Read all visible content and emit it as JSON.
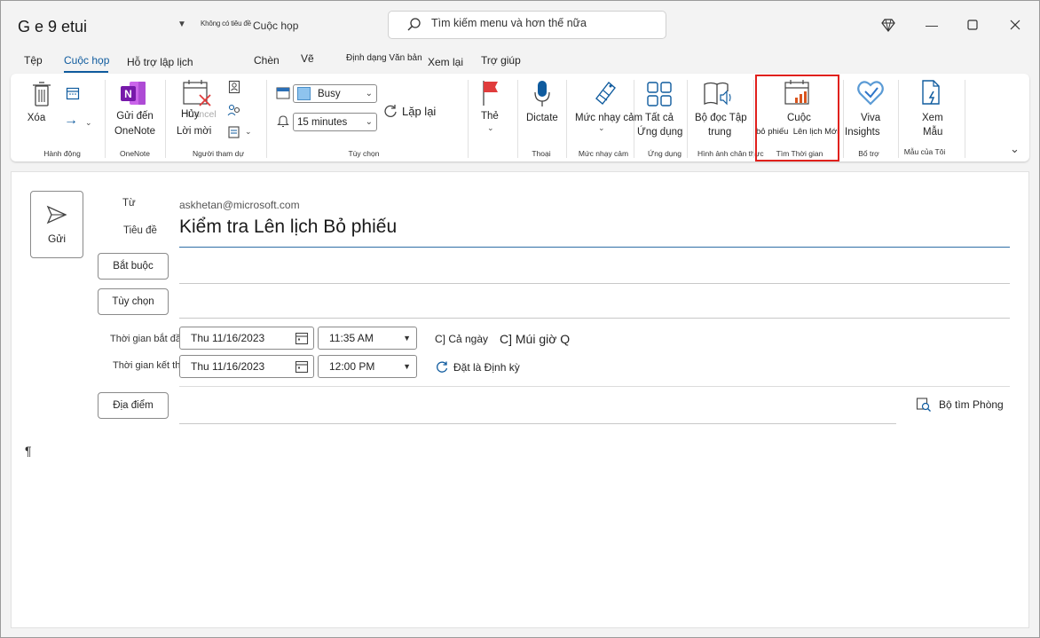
{
  "title_bar": {
    "app_title": "G e 9 etui",
    "qat_small_text": "Không có tiêu đề",
    "qat_item": "Cuộc họp",
    "search_placeholder": "Tìm kiếm menu và hơn thế nữa",
    "icons": [
      "search-icon",
      "diamond-icon",
      "minimize-icon",
      "maximize-icon",
      "close-icon"
    ]
  },
  "tabs": [
    {
      "label": "Tệp"
    },
    {
      "label": "Cuộc họp",
      "active": true
    },
    {
      "label": "Hỗ trợ lập lịch"
    },
    {
      "label": "Chèn"
    },
    {
      "label": "Vẽ"
    },
    {
      "label": "Định dạng Văn bản"
    },
    {
      "label": "Xem lại"
    },
    {
      "label": "Trợ giúp"
    }
  ],
  "ribbon": {
    "groups": {
      "actions": "Hành động",
      "onenote": "OneNote",
      "attendees": "Người tham dự",
      "options": "Tùy chọn",
      "voice": "Thoại",
      "sensitivity": "Mức nhạy cảm",
      "apps": "Ứng dụng",
      "immersive": "Hình ảnh chân thực",
      "find_time": "Tìm Thời gian",
      "addins": "Bổ trợ",
      "templates": "Mẫu của Tôi"
    },
    "delete_label": "Xóa",
    "onenote_label_1": "Gửi đến",
    "onenote_label_2": "OneNote",
    "cancel_label_1": "Hủy",
    "cancel_label_ghost": "Cancel",
    "cancel_label_2": "Lời mời",
    "busy_value": "Busy",
    "reminder_value": "15 minutes",
    "recurrence_label": "Lặp lại",
    "tags_label": "Thẻ",
    "dictate_label": "Dictate",
    "sensitivity_label": "Mức nhạy cảm",
    "all_apps_1": "Tất cả",
    "all_apps_2": "Ứng dụng",
    "reader_1": "Bộ đọc Tập",
    "reader_2": "trung",
    "poll_1": "Cuộc",
    "poll_2": "bỏ phiếu  Lên lịch Mới",
    "viva_1": "Viva",
    "viva_2": "Insights",
    "view_1": "Xem",
    "view_2": "Mẫu",
    "colors": {
      "accent": "#0f5b9e",
      "highlight": "#e0201c",
      "onenote": "#7719aa",
      "flag": "#e03c3c"
    }
  },
  "form": {
    "send_label": "Gửi",
    "from_label": "Từ",
    "from_value": "askhetan@microsoft.com",
    "subject_label": "Tiêu đề",
    "subject_value": "Kiểm tra Lên lịch Bỏ phiếu",
    "required_button": "Bắt buộc",
    "optional_button": "Tùy chọn",
    "start_label": "Thời gian bắt đầu",
    "start_date": "Thu 11/16/2023",
    "start_time": "11:35 AM",
    "end_label": "Thời gian kết thúc",
    "end_date": "Thu 11/16/2023",
    "end_time": "12:00 PM",
    "all_day": "C] Cả ngày",
    "timezone": "C] Múi giờ Q",
    "recurring": "Đặt là Định kỳ",
    "location_button": "Địa điểm",
    "room_finder": "Bộ tìm Phòng",
    "body_mark": "¶"
  }
}
